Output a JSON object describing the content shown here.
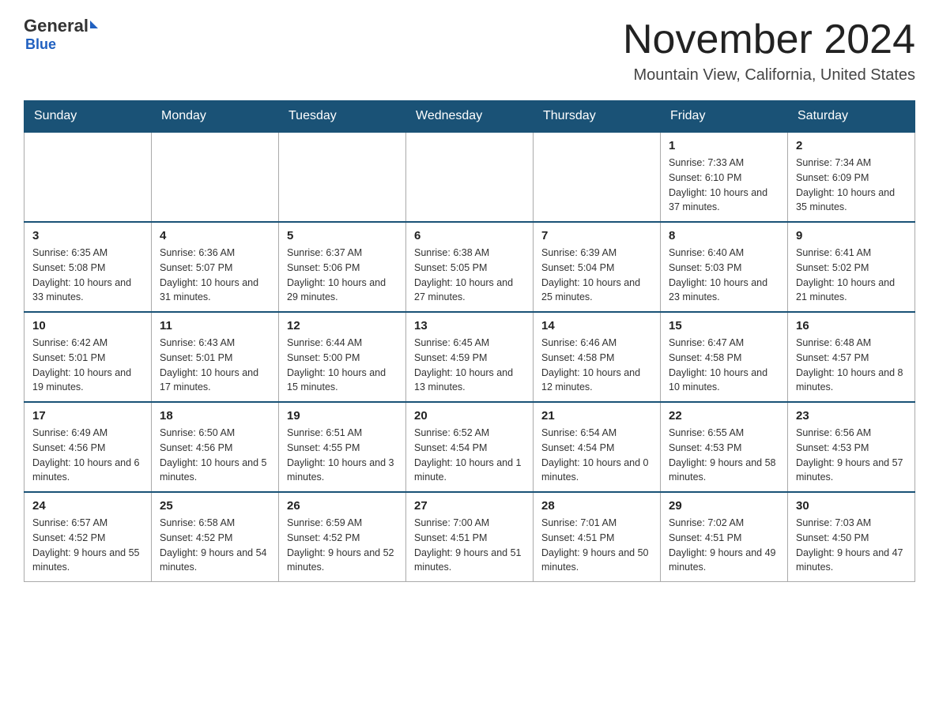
{
  "header": {
    "logo_general": "General",
    "logo_blue": "Blue",
    "month": "November 2024",
    "location": "Mountain View, California, United States"
  },
  "weekdays": [
    "Sunday",
    "Monday",
    "Tuesday",
    "Wednesday",
    "Thursday",
    "Friday",
    "Saturday"
  ],
  "weeks": [
    [
      {
        "day": "",
        "info": ""
      },
      {
        "day": "",
        "info": ""
      },
      {
        "day": "",
        "info": ""
      },
      {
        "day": "",
        "info": ""
      },
      {
        "day": "",
        "info": ""
      },
      {
        "day": "1",
        "info": "Sunrise: 7:33 AM\nSunset: 6:10 PM\nDaylight: 10 hours and 37 minutes."
      },
      {
        "day": "2",
        "info": "Sunrise: 7:34 AM\nSunset: 6:09 PM\nDaylight: 10 hours and 35 minutes."
      }
    ],
    [
      {
        "day": "3",
        "info": "Sunrise: 6:35 AM\nSunset: 5:08 PM\nDaylight: 10 hours and 33 minutes."
      },
      {
        "day": "4",
        "info": "Sunrise: 6:36 AM\nSunset: 5:07 PM\nDaylight: 10 hours and 31 minutes."
      },
      {
        "day": "5",
        "info": "Sunrise: 6:37 AM\nSunset: 5:06 PM\nDaylight: 10 hours and 29 minutes."
      },
      {
        "day": "6",
        "info": "Sunrise: 6:38 AM\nSunset: 5:05 PM\nDaylight: 10 hours and 27 minutes."
      },
      {
        "day": "7",
        "info": "Sunrise: 6:39 AM\nSunset: 5:04 PM\nDaylight: 10 hours and 25 minutes."
      },
      {
        "day": "8",
        "info": "Sunrise: 6:40 AM\nSunset: 5:03 PM\nDaylight: 10 hours and 23 minutes."
      },
      {
        "day": "9",
        "info": "Sunrise: 6:41 AM\nSunset: 5:02 PM\nDaylight: 10 hours and 21 minutes."
      }
    ],
    [
      {
        "day": "10",
        "info": "Sunrise: 6:42 AM\nSunset: 5:01 PM\nDaylight: 10 hours and 19 minutes."
      },
      {
        "day": "11",
        "info": "Sunrise: 6:43 AM\nSunset: 5:01 PM\nDaylight: 10 hours and 17 minutes."
      },
      {
        "day": "12",
        "info": "Sunrise: 6:44 AM\nSunset: 5:00 PM\nDaylight: 10 hours and 15 minutes."
      },
      {
        "day": "13",
        "info": "Sunrise: 6:45 AM\nSunset: 4:59 PM\nDaylight: 10 hours and 13 minutes."
      },
      {
        "day": "14",
        "info": "Sunrise: 6:46 AM\nSunset: 4:58 PM\nDaylight: 10 hours and 12 minutes."
      },
      {
        "day": "15",
        "info": "Sunrise: 6:47 AM\nSunset: 4:58 PM\nDaylight: 10 hours and 10 minutes."
      },
      {
        "day": "16",
        "info": "Sunrise: 6:48 AM\nSunset: 4:57 PM\nDaylight: 10 hours and 8 minutes."
      }
    ],
    [
      {
        "day": "17",
        "info": "Sunrise: 6:49 AM\nSunset: 4:56 PM\nDaylight: 10 hours and 6 minutes."
      },
      {
        "day": "18",
        "info": "Sunrise: 6:50 AM\nSunset: 4:56 PM\nDaylight: 10 hours and 5 minutes."
      },
      {
        "day": "19",
        "info": "Sunrise: 6:51 AM\nSunset: 4:55 PM\nDaylight: 10 hours and 3 minutes."
      },
      {
        "day": "20",
        "info": "Sunrise: 6:52 AM\nSunset: 4:54 PM\nDaylight: 10 hours and 1 minute."
      },
      {
        "day": "21",
        "info": "Sunrise: 6:54 AM\nSunset: 4:54 PM\nDaylight: 10 hours and 0 minutes."
      },
      {
        "day": "22",
        "info": "Sunrise: 6:55 AM\nSunset: 4:53 PM\nDaylight: 9 hours and 58 minutes."
      },
      {
        "day": "23",
        "info": "Sunrise: 6:56 AM\nSunset: 4:53 PM\nDaylight: 9 hours and 57 minutes."
      }
    ],
    [
      {
        "day": "24",
        "info": "Sunrise: 6:57 AM\nSunset: 4:52 PM\nDaylight: 9 hours and 55 minutes."
      },
      {
        "day": "25",
        "info": "Sunrise: 6:58 AM\nSunset: 4:52 PM\nDaylight: 9 hours and 54 minutes."
      },
      {
        "day": "26",
        "info": "Sunrise: 6:59 AM\nSunset: 4:52 PM\nDaylight: 9 hours and 52 minutes."
      },
      {
        "day": "27",
        "info": "Sunrise: 7:00 AM\nSunset: 4:51 PM\nDaylight: 9 hours and 51 minutes."
      },
      {
        "day": "28",
        "info": "Sunrise: 7:01 AM\nSunset: 4:51 PM\nDaylight: 9 hours and 50 minutes."
      },
      {
        "day": "29",
        "info": "Sunrise: 7:02 AM\nSunset: 4:51 PM\nDaylight: 9 hours and 49 minutes."
      },
      {
        "day": "30",
        "info": "Sunrise: 7:03 AM\nSunset: 4:50 PM\nDaylight: 9 hours and 47 minutes."
      }
    ]
  ]
}
